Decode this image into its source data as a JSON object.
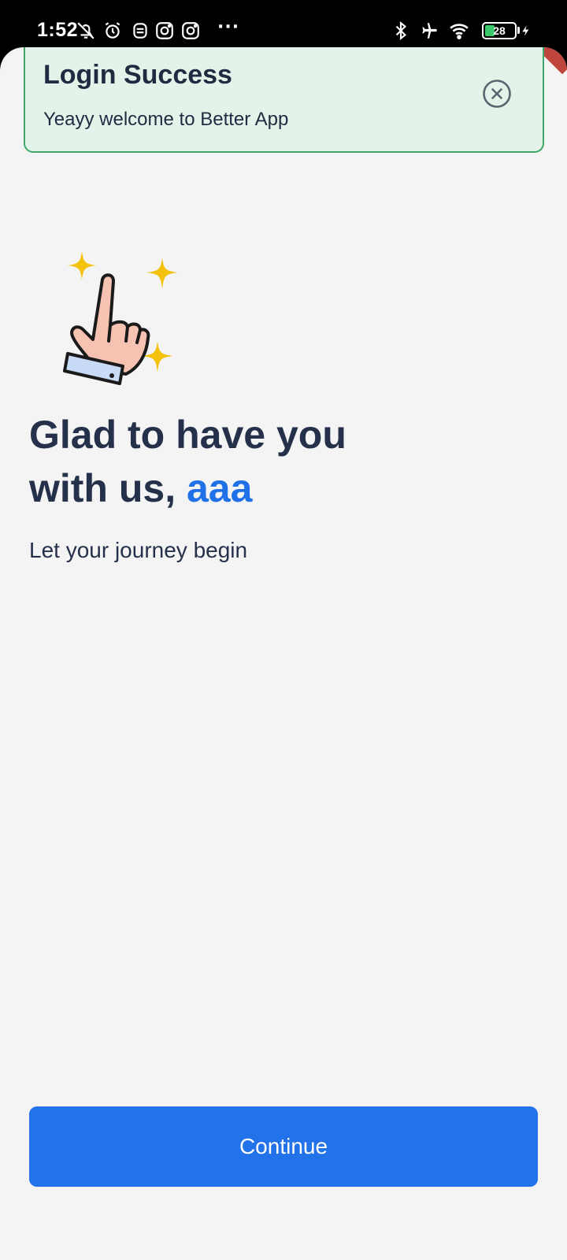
{
  "status_bar": {
    "time": "1:52",
    "more": "···",
    "battery_level": "28",
    "icons": [
      "bell-off-icon",
      "alarm-icon",
      "app-icon",
      "instagram-icon",
      "instagram-icon",
      "bluetooth-icon",
      "airplane-icon",
      "wifi-icon",
      "battery-icon",
      "charging-icon"
    ]
  },
  "toast": {
    "title": "Login Success",
    "message": "Yeayy welcome to Better App",
    "close_icon": "close-circle-icon",
    "accent": "#3da86a",
    "background": "#e4f3ea"
  },
  "welcome": {
    "heading_line1": "Glad to have you",
    "heading_line2_prefix": "with us, ",
    "user_name": "aaa",
    "subtitle": "Let your journey begin",
    "illustration": "pointing-hand-sparkles-icon"
  },
  "actions": {
    "continue_label": "Continue"
  },
  "colors": {
    "primary": "#2272ea",
    "text": "#25304a",
    "background": "#f4f4f4"
  }
}
